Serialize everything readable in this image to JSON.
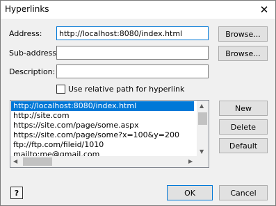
{
  "window": {
    "title": "Hyperlinks"
  },
  "form": {
    "address_label": "Address:",
    "address_value": "http://localhost:8080/index.html",
    "subaddress_label": "Sub-address:",
    "subaddress_value": "",
    "description_label": "Description:",
    "description_value": "",
    "relative_label": "Use relative path for hyperlink",
    "relative_checked": false
  },
  "buttons": {
    "browse1": "Browse...",
    "browse2": "Browse...",
    "new": "New",
    "delete": "Delete",
    "default": "Default",
    "ok": "OK",
    "cancel": "Cancel",
    "help": "?"
  },
  "hyperlinks": {
    "items": [
      "http://localhost:8080/index.html",
      "http://site.com",
      "https://site.com/page/some.aspx",
      "https://site.com/page/some?x=100&y=200",
      "ftp://ftp.com/fileid/1010",
      "mailto:me@gmail.com"
    ],
    "selected_index": 0
  },
  "icons": {
    "close": "close-icon",
    "help": "help-icon",
    "scroll_up": "chevron-up-icon",
    "scroll_down": "chevron-down-icon",
    "scroll_left": "chevron-left-icon",
    "scroll_right": "chevron-right-icon"
  }
}
